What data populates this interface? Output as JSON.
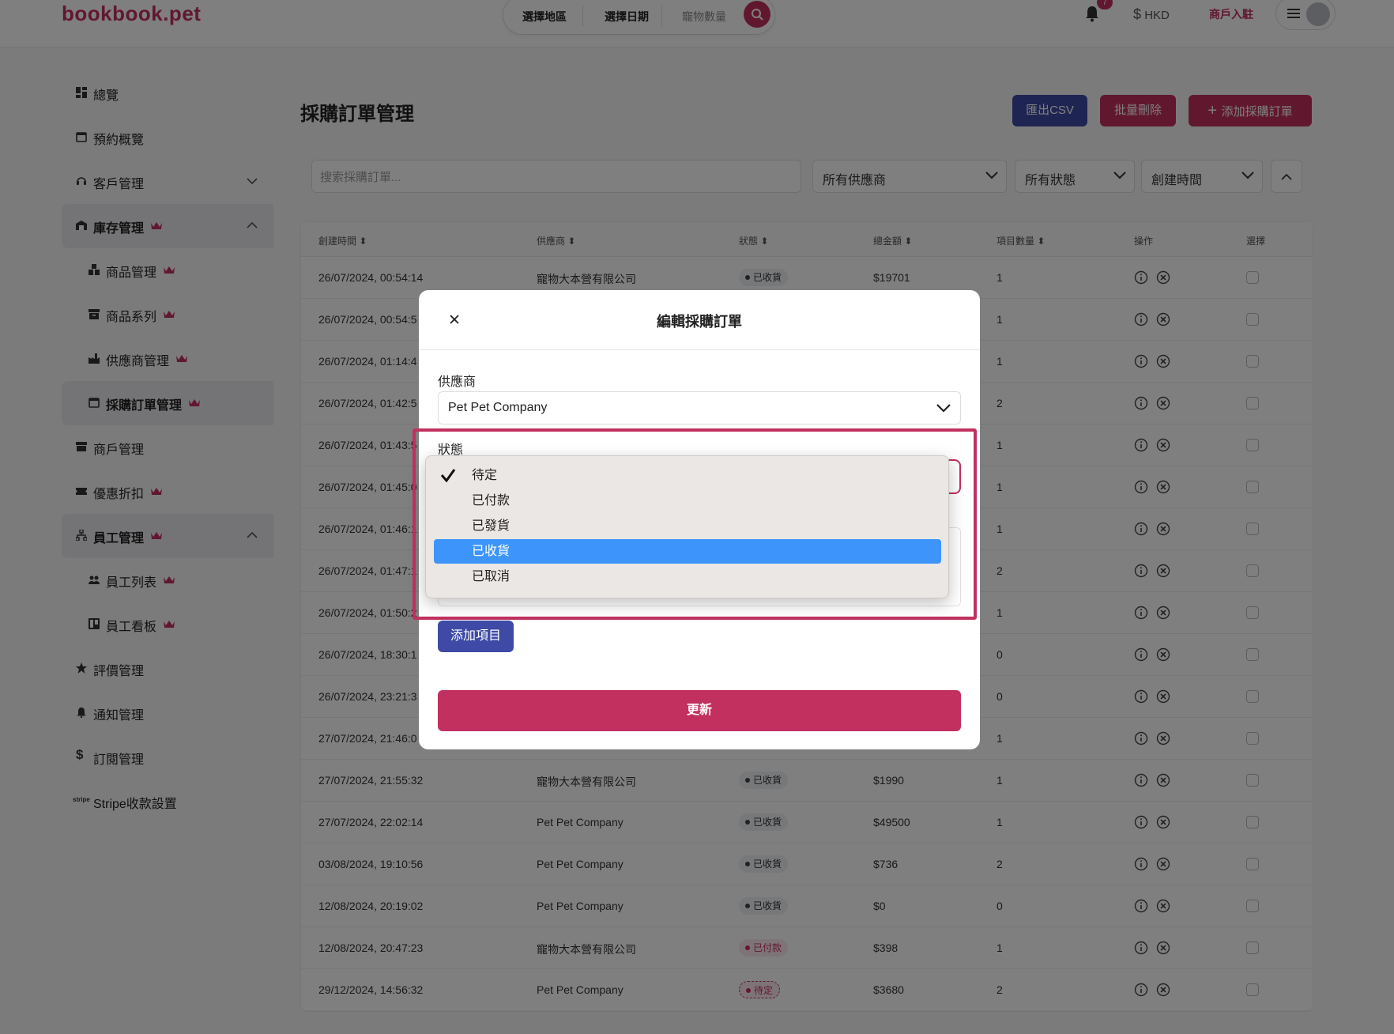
{
  "app": {
    "logo": "bookbook.pet"
  },
  "header": {
    "search": {
      "region": "選擇地區",
      "date": "選擇日期",
      "pets": "寵物數量"
    },
    "notification_count": "7",
    "currency": "HKD",
    "merchant_link": "商戶入駐"
  },
  "sidebar": {
    "items": [
      {
        "label": "總覽"
      },
      {
        "label": "預約概覽"
      },
      {
        "label": "客戶管理"
      },
      {
        "label": "庫存管理"
      },
      {
        "label": "商品管理"
      },
      {
        "label": "商品系列"
      },
      {
        "label": "供應商管理"
      },
      {
        "label": "採購訂單管理"
      },
      {
        "label": "商戶管理"
      },
      {
        "label": "優惠折扣"
      },
      {
        "label": "員工管理"
      },
      {
        "label": "員工列表"
      },
      {
        "label": "員工看板"
      },
      {
        "label": "評價管理"
      },
      {
        "label": "通知管理"
      },
      {
        "label": "訂閱管理"
      },
      {
        "label": "Stripe收款設置"
      }
    ]
  },
  "main": {
    "title": "採購訂單管理",
    "buttons": {
      "export": "匯出CSV",
      "bulk_delete": "批量刪除",
      "add": "添加採購訂單"
    },
    "filters": {
      "search_placeholder": "搜索採購訂單...",
      "supplier": "所有供應商",
      "status": "所有狀態",
      "sort": "創建時間"
    },
    "table": {
      "headers": [
        "創建時間",
        "供應商",
        "狀態",
        "總金額",
        "項目數量",
        "操作",
        "選擇"
      ],
      "rows": [
        {
          "time": "26/07/2024, 00:54:14",
          "supplier": "寵物大本營有限公司",
          "status": "已收貨",
          "total": "$19701",
          "qty": "1"
        },
        {
          "time": "26/07/2024, 00:54:5",
          "supplier": "",
          "status": "",
          "total": "",
          "qty": "1"
        },
        {
          "time": "26/07/2024, 01:14:4",
          "supplier": "",
          "status": "",
          "total": "",
          "qty": "1"
        },
        {
          "time": "26/07/2024, 01:42:5",
          "supplier": "",
          "status": "",
          "total": "",
          "qty": "2"
        },
        {
          "time": "26/07/2024, 01:43:5",
          "supplier": "",
          "status": "",
          "total": "",
          "qty": "1"
        },
        {
          "time": "26/07/2024, 01:45:0",
          "supplier": "",
          "status": "",
          "total": "",
          "qty": "1"
        },
        {
          "time": "26/07/2024, 01:46:1",
          "supplier": "",
          "status": "",
          "total": "",
          "qty": "1"
        },
        {
          "time": "26/07/2024, 01:47:1",
          "supplier": "",
          "status": "",
          "total": "",
          "qty": "2"
        },
        {
          "time": "26/07/2024, 01:50:2",
          "supplier": "",
          "status": "",
          "total": "",
          "qty": "1"
        },
        {
          "time": "26/07/2024, 18:30:1",
          "supplier": "",
          "status": "",
          "total": "",
          "qty": "0"
        },
        {
          "time": "26/07/2024, 23:21:3",
          "supplier": "",
          "status": "",
          "total": "",
          "qty": "0"
        },
        {
          "time": "27/07/2024, 21:46:0",
          "supplier": "",
          "status": "",
          "total": "",
          "qty": "1"
        },
        {
          "time": "27/07/2024, 21:55:32",
          "supplier": "寵物大本營有限公司",
          "status": "已收貨",
          "total": "$1990",
          "qty": "1"
        },
        {
          "time": "27/07/2024, 22:02:14",
          "supplier": "Pet Pet Company",
          "status": "已收貨",
          "total": "$49500",
          "qty": "1"
        },
        {
          "time": "03/08/2024, 19:10:56",
          "supplier": "Pet Pet Company",
          "status": "已收貨",
          "total": "$736",
          "qty": "2"
        },
        {
          "time": "12/08/2024, 20:19:02",
          "supplier": "Pet Pet Company",
          "status": "已收貨",
          "total": "$0",
          "qty": "0"
        },
        {
          "time": "12/08/2024, 20:47:23",
          "supplier": "寵物大本營有限公司",
          "status": "已付款",
          "total": "$398",
          "qty": "1"
        },
        {
          "time": "29/12/2024, 14:56:32",
          "supplier": "Pet Pet Company",
          "status": "待定",
          "total": "$3680",
          "qty": "2"
        }
      ]
    }
  },
  "modal": {
    "title": "編輯採購訂單",
    "supplier_label": "供應商",
    "supplier_value": "Pet Pet Company",
    "status_label": "狀態",
    "add_item": "添加項目",
    "update": "更新",
    "status_options": [
      {
        "label": "待定",
        "checked": true
      },
      {
        "label": "已付款"
      },
      {
        "label": "已發貨"
      },
      {
        "label": "已收貨",
        "highlighted": true
      },
      {
        "label": "已取消"
      }
    ]
  },
  "colors": {
    "brand": "#c2305f",
    "secondary": "#3e4aa6",
    "dropdown_highlight": "#3d95fb"
  }
}
